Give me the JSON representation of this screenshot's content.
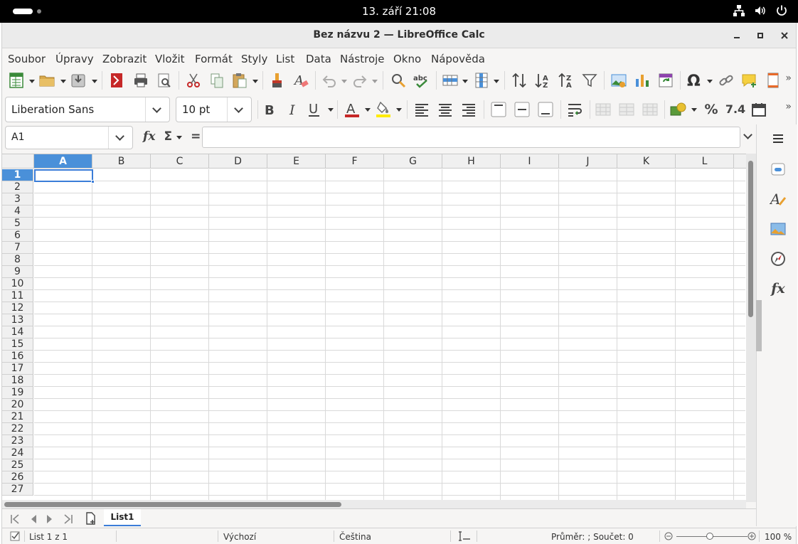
{
  "topbar": {
    "clock": "13. září  21:08"
  },
  "window": {
    "title": "Bez názvu 2 — LibreOffice Calc"
  },
  "menu": [
    "Soubor",
    "Úpravy",
    "Zobrazit",
    "Vložit",
    "Formát",
    "Styly",
    "List",
    "Data",
    "Nástroje",
    "Okno",
    "Nápověda"
  ],
  "format_toolbar": {
    "font_name": "Liberation Sans",
    "font_size": "10 pt",
    "number_format_label": "7.4",
    "percent_label": "%"
  },
  "formula_bar": {
    "name_box": "A1",
    "function_label": "fx",
    "sum_label": "Σ",
    "equals_label": "=",
    "formula": ""
  },
  "grid": {
    "columns": [
      "A",
      "B",
      "C",
      "D",
      "E",
      "F",
      "G",
      "H",
      "I",
      "J",
      "K",
      "L"
    ],
    "rows": [
      "1",
      "2",
      "3",
      "4",
      "5",
      "6",
      "7",
      "8",
      "9",
      "10",
      "11",
      "12",
      "13",
      "14",
      "15",
      "16",
      "17",
      "18",
      "19",
      "20",
      "21",
      "22",
      "23",
      "24",
      "25",
      "26",
      "27"
    ],
    "selected_cell": "A1"
  },
  "sheet_tabs": [
    "List1"
  ],
  "statusbar": {
    "sheet": "List 1 z 1",
    "page_style": "Výchozí",
    "language": "Čeština",
    "summary": "Průměr: ; Součet: 0",
    "zoom": "100 %"
  },
  "sidebar": {
    "functions_label": "fx"
  },
  "colors": {
    "selection": "#4a90d9",
    "accent": "#3b7dd8"
  }
}
